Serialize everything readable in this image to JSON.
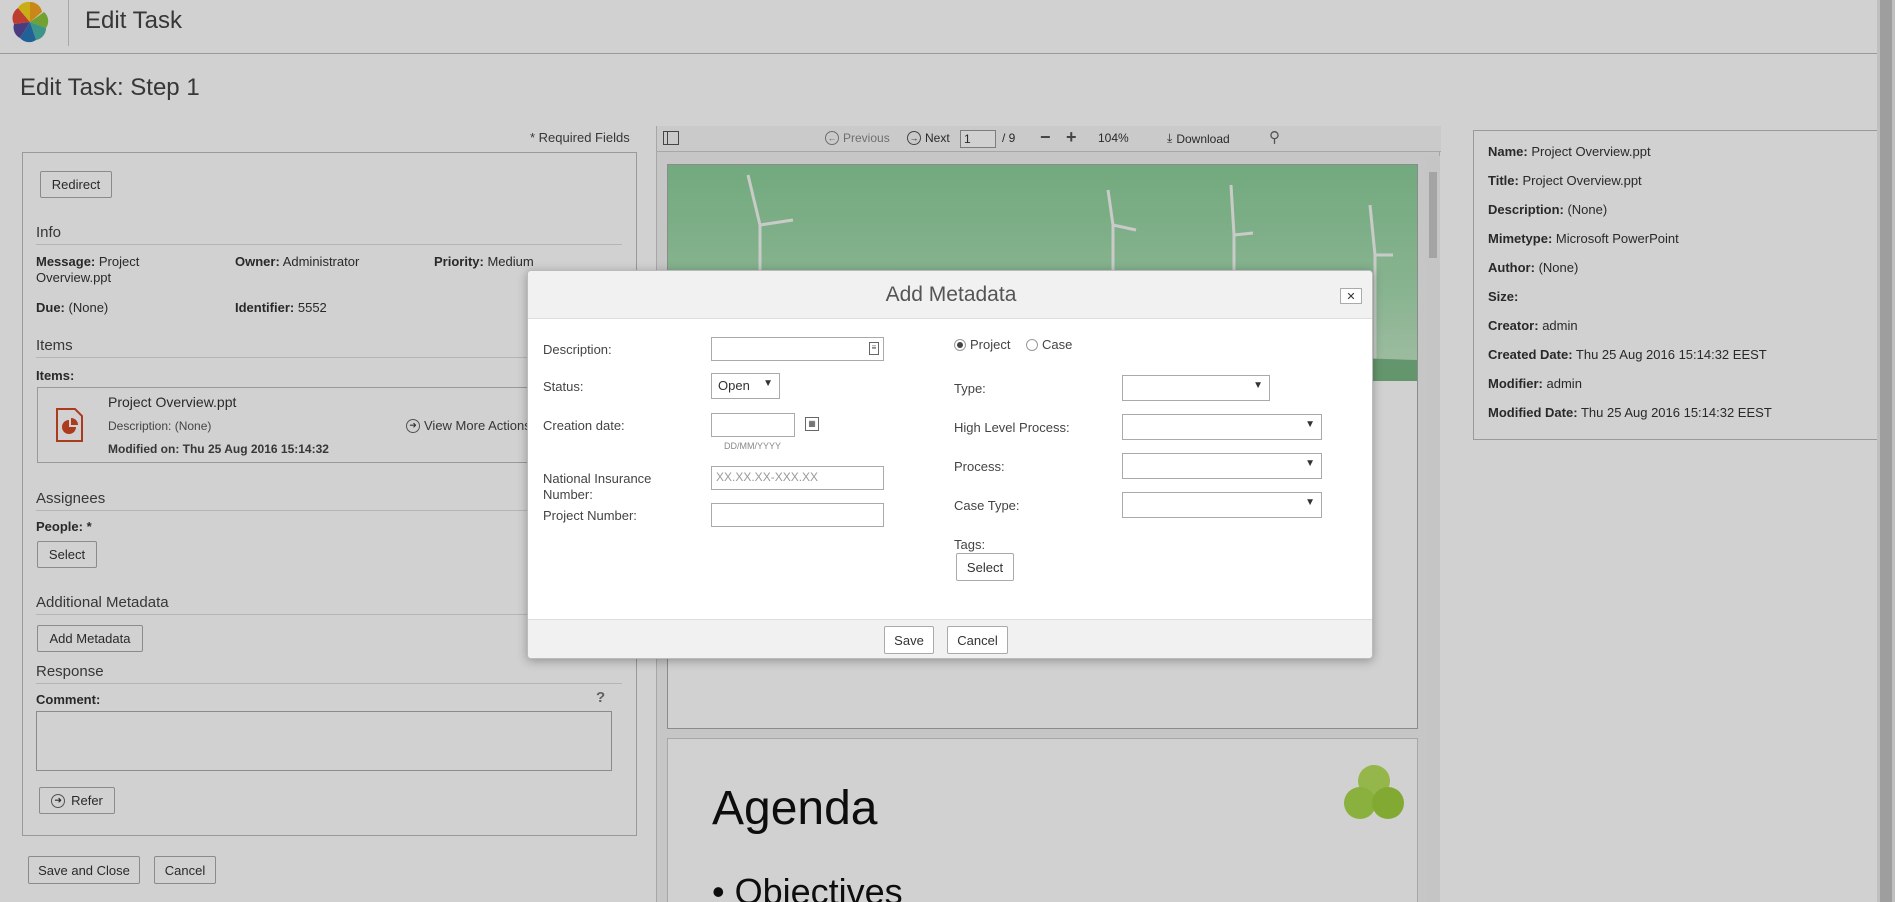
{
  "header": {
    "app_title": "Edit Task"
  },
  "page": {
    "title": "Edit Task: Step 1",
    "required_fields": "* Required Fields"
  },
  "form": {
    "redirect_label": "Redirect",
    "info": {
      "title": "Info",
      "message_label": "Message:",
      "message_value": "Project Overview.ppt",
      "owner_label": "Owner:",
      "owner_value": "Administrator",
      "priority_label": "Priority:",
      "priority_value": "Medium",
      "due_label": "Due:",
      "due_value": "(None)",
      "identifier_label": "Identifier:",
      "identifier_value": "5552"
    },
    "items": {
      "title": "Items",
      "items_label": "Items:",
      "file_name": "Project Overview.ppt",
      "description": "Description: (None)",
      "modified": "Modified on: Thu 25 Aug 2016 15:14:32",
      "view_more": "View More Actions"
    },
    "assignees": {
      "title": "Assignees",
      "people_label": "People: *",
      "select_label": "Select"
    },
    "additional": {
      "title": "Additional Metadata",
      "add_metadata_label": "Add Metadata"
    },
    "response": {
      "title": "Response",
      "comment_label": "Comment:",
      "help": "?",
      "refer_label": "Refer"
    },
    "save_close_label": "Save and Close",
    "cancel_label": "Cancel"
  },
  "viewer": {
    "previous": "Previous",
    "next": "Next",
    "page": "1",
    "page_total": "/ 9",
    "zoom": "104%",
    "download": "Download",
    "slide2_title": "Agenda",
    "slide2_bullet": "Objectives"
  },
  "properties": [
    {
      "label": "Name:",
      "value": "Project Overview.ppt"
    },
    {
      "label": "Title:",
      "value": "Project Overview.ppt"
    },
    {
      "label": "Description:",
      "value": "(None)"
    },
    {
      "label": "Mimetype:",
      "value": "Microsoft PowerPoint"
    },
    {
      "label": "Author:",
      "value": "(None)"
    },
    {
      "label": "Size:",
      "value": ""
    },
    {
      "label": "Creator:",
      "value": "admin"
    },
    {
      "label": "Created Date:",
      "value": "Thu 25 Aug 2016 15:14:32 EEST"
    },
    {
      "label": "Modifier:",
      "value": "admin"
    },
    {
      "label": "Modified Date:",
      "value": "Thu 25 Aug 2016 15:14:32 EEST"
    }
  ],
  "modal": {
    "title": "Add Metadata",
    "close": "✕",
    "description_label": "Description:",
    "status_label": "Status:",
    "status_value": "Open",
    "creation_date_label": "Creation date:",
    "date_hint": "DD/MM/YYYY",
    "ni_label_1": "National Insurance",
    "ni_label_2": "Number:",
    "ni_placeholder": "XX.XX.XX-XXX.XX",
    "project_number_label": "Project Number:",
    "radio_project": "Project",
    "radio_case": "Case",
    "type_label": "Type:",
    "hlp_label": "High Level Process:",
    "process_label": "Process:",
    "case_type_label": "Case Type:",
    "tags_label": "Tags:",
    "select_label": "Select",
    "save_label": "Save",
    "cancel_label": "Cancel"
  }
}
